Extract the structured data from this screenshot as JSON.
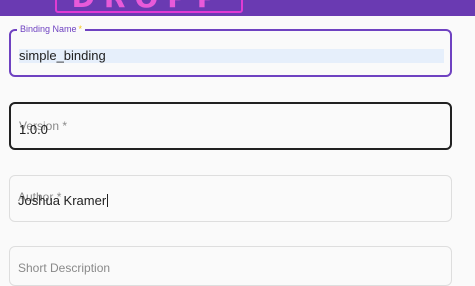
{
  "header": {
    "logo_text": "DROPP"
  },
  "form": {
    "binding_name": {
      "label": "Binding Name",
      "required_mark": "*",
      "value": "simple_binding"
    },
    "version": {
      "label": "Version *",
      "value": "1.0.0"
    },
    "author": {
      "label": "Author *",
      "value": "Joshua Kramer"
    },
    "next_field": {
      "label": "Short Description"
    }
  }
}
